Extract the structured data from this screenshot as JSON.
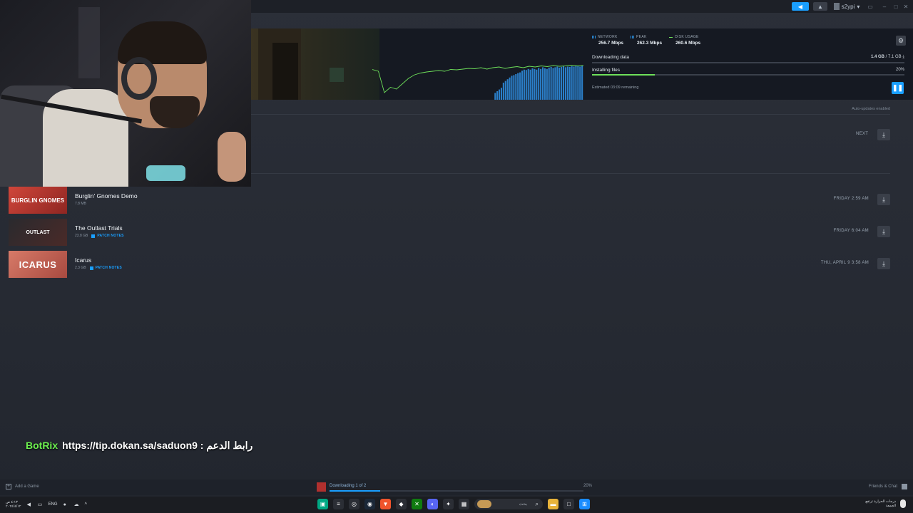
{
  "titlebar": {
    "username": "s2ypi",
    "notify_icon": "announcement-icon",
    "bell_icon": "bell-icon"
  },
  "download": {
    "stats": [
      {
        "label": "NETWORK",
        "value": "256.7 Mbps",
        "swatch": "bars"
      },
      {
        "label": "PEAK",
        "value": "262.3 Mbps",
        "swatch": "bars"
      },
      {
        "label": "DISK USAGE",
        "value": "260.6 Mbps",
        "swatch": "line"
      }
    ],
    "downloading_label": "Downloading data",
    "downloaded": "1.4 GB",
    "total": " / 7.1 GB",
    "installing_label": "Installing files",
    "installing_pct": "20%",
    "installing_progress": 0.2,
    "downloading_progress": 0.99,
    "estimate": "Estimated 03:09 remaining",
    "graph_network": [
      0,
      0,
      0,
      0,
      0,
      0,
      0,
      0,
      0,
      0,
      0,
      0,
      0,
      0,
      0,
      0,
      0,
      0,
      0,
      0,
      0,
      0,
      0,
      0,
      0,
      0,
      0,
      0,
      0,
      0,
      0,
      0,
      0,
      0,
      0,
      0,
      0,
      0,
      0,
      0,
      0,
      0,
      0,
      0,
      0,
      0,
      0,
      0,
      0,
      0,
      0,
      0,
      0,
      0,
      0,
      0,
      0,
      0,
      0,
      0.2,
      0.25,
      0.3,
      0.35,
      0.5,
      0.55,
      0.6,
      0.65,
      0.7,
      0.72,
      0.75,
      0.78,
      0.8,
      0.85,
      0.88,
      0.87,
      0.9,
      0.88,
      0.92,
      0.9,
      0.88,
      0.93,
      0.9,
      0.95,
      0.92,
      0.9,
      0.94,
      0.96,
      0.93,
      0.95,
      0.97,
      0.94,
      0.96,
      0.98,
      0.95,
      0.97,
      0.96,
      0.98,
      0.97,
      0.99,
      0.98,
      0.97,
      0.99
    ],
    "graph_disk": [
      0.85,
      0.8,
      0.2,
      0.35,
      0.3,
      0.45,
      0.6,
      0.7,
      0.75,
      0.78,
      0.8,
      0.82,
      0.8,
      0.85,
      0.84,
      0.86,
      0.88,
      0.87,
      0.9,
      0.86,
      0.9,
      0.92,
      0.88,
      0.91,
      0.93,
      0.9,
      0.94,
      0.92,
      0.95,
      0.93,
      0.96,
      0.94,
      0.95,
      0.97,
      0.95,
      0.96
    ]
  },
  "auto_updates": "Auto-updates enabled",
  "next_label": "NEXT",
  "games": [
    {
      "name": "Burglin' Gnomes Demo",
      "size": "7.8 MB",
      "patch_notes": "",
      "date": "FRIDAY 2:59 AM",
      "thumb_text": "BURGLIN GNOMES",
      "thumb_color": "#b8362c"
    },
    {
      "name": "The Outlast Trials",
      "size": "23.8 GB",
      "patch_notes": "PATCH NOTES",
      "date": "FRIDAY 6:04 AM",
      "thumb_text": "OUTLAST",
      "thumb_color": "#3a2a28"
    },
    {
      "name": "Icarus",
      "size": "2.3 GB",
      "patch_notes": "PATCH NOTES",
      "date": "THU, APRIL 9 3:58 AM",
      "thumb_text": "ICARUS",
      "thumb_color": "#c9685a"
    }
  ],
  "overlay": {
    "brand": "BotRix",
    "text": "رابط الدعم : https://tip.dokan.sa/saduon9"
  },
  "bottom": {
    "add_game": "Add a Game",
    "downloading_status": "Downloading 1 of 2",
    "progress_pct": "20%",
    "progress_value": 0.2,
    "friends": "Friends & Chat"
  },
  "taskbar": {
    "clock_time": "٤:١٣ ص",
    "clock_date": "٢٠٢٤/٤/١٢",
    "lang": "ENG",
    "search_placeholder": "بحث",
    "weather_line1": "درجات الحرارة ترتفع",
    "weather_line2": "الجمعة",
    "apps": [
      {
        "icon": "chat-app-icon",
        "color": "#00a884",
        "glyph": "▣"
      },
      {
        "icon": "terminal-icon",
        "color": "#2b2e35",
        "glyph": "≡"
      },
      {
        "icon": "chrome-icon",
        "color": "#2b2e35",
        "glyph": "◎"
      },
      {
        "icon": "steam-icon",
        "color": "#1b2838",
        "glyph": "◉"
      },
      {
        "icon": "brave-icon",
        "color": "#f0542c",
        "glyph": "▼"
      },
      {
        "icon": "epic-icon",
        "color": "#2b2e35",
        "glyph": "◆"
      },
      {
        "icon": "xbox-icon",
        "color": "#107c10",
        "glyph": "✕"
      },
      {
        "icon": "discord-icon",
        "color": "#5865f2",
        "glyph": "◐"
      },
      {
        "icon": "steelseries-icon",
        "color": "#2b2e35",
        "glyph": "✦"
      },
      {
        "icon": "calendar-icon",
        "color": "#2b2e35",
        "glyph": "▦"
      },
      {
        "icon": "folder-icon",
        "color": "#e8b33a",
        "glyph": "▬"
      },
      {
        "icon": "window-icon",
        "color": "#2b2e35",
        "glyph": "□"
      }
    ]
  }
}
